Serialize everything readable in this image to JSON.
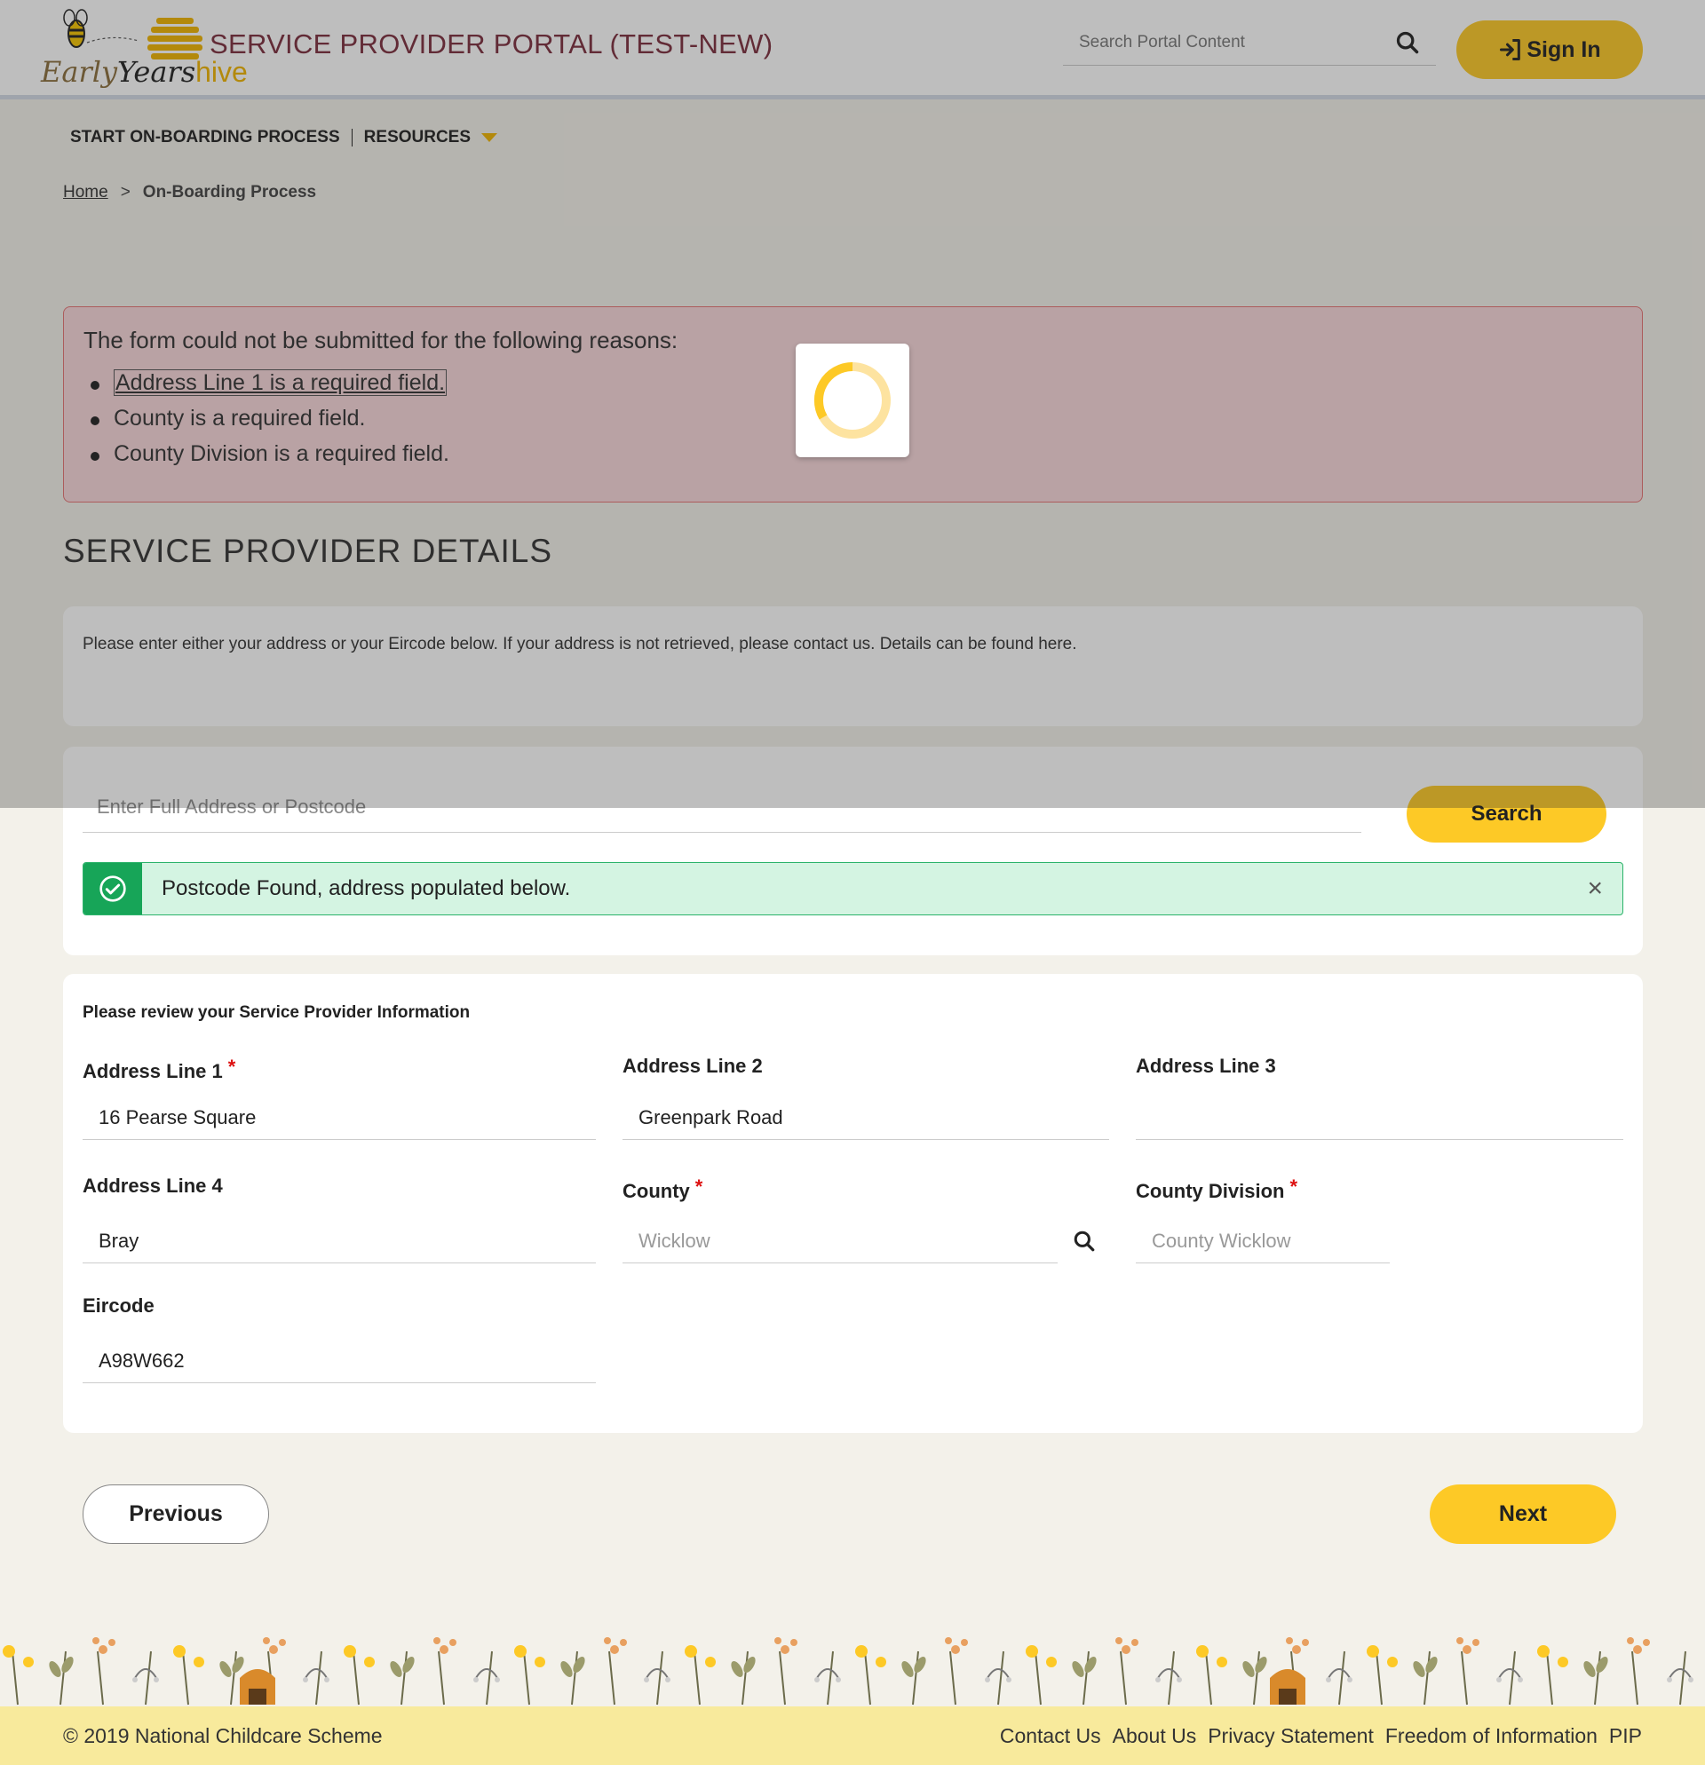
{
  "header": {
    "logo_text_early": "Early",
    "logo_text_years": "Years",
    "logo_text_hive": "hive",
    "portal_title": "SERVICE PROVIDER PORTAL (TEST-NEW)",
    "search_placeholder": "Search Portal Content",
    "signin_label": "Sign In"
  },
  "nav": {
    "items": [
      "START ON-BOARDING PROCESS",
      "RESOURCES"
    ]
  },
  "breadcrumb": {
    "home": "Home",
    "separator": ">",
    "current": "On-Boarding Process"
  },
  "errors": {
    "title": "The form could not be submitted for the following reasons:",
    "items": [
      "Address Line 1 is a required field.",
      "County is a required field.",
      "County Division is a required field."
    ]
  },
  "section_title": "SERVICE PROVIDER DETAILS",
  "info_text": "Please enter either your address or your Eircode below. If your address is not retrieved, please contact us. Details can be found here.",
  "address_search": {
    "placeholder": "Enter Full Address or Postcode",
    "button_label": "Search",
    "success_message": "Postcode Found, address populated below.",
    "close_glyph": "×"
  },
  "form": {
    "heading": "Please review your Service Provider Information",
    "required_mark": "*",
    "address_line_1": {
      "label": "Address Line 1",
      "value": "16 Pearse Square"
    },
    "address_line_2": {
      "label": "Address Line 2",
      "value": "Greenpark Road"
    },
    "address_line_3": {
      "label": "Address Line 3",
      "value": ""
    },
    "address_line_4": {
      "label": "Address Line 4",
      "value": "Bray"
    },
    "county": {
      "label": "County",
      "placeholder": "Wicklow"
    },
    "county_division": {
      "label": "County Division",
      "placeholder": "County Wicklow"
    },
    "eircode": {
      "label": "Eircode",
      "value": "A98W662"
    }
  },
  "buttons": {
    "previous": "Previous",
    "next": "Next"
  },
  "footer": {
    "copyright": "© 2019 National Childcare Scheme",
    "links": [
      "Contact Us",
      "About Us",
      "Privacy Statement",
      "Freedom of Information",
      "PIP"
    ]
  },
  "colors": {
    "brand_yellow": "#fdc926",
    "title_maroon": "#7b2d3d",
    "error_bg": "#f8d7da",
    "success_bg": "#d4f4e2",
    "success_accent": "#17a558",
    "footer_bg": "#f8ea9c"
  },
  "icons": {
    "search": "search-icon",
    "signin": "sign-in-icon",
    "success": "check-circle-icon",
    "close": "close-icon",
    "loading": "loading-spinner-icon"
  }
}
